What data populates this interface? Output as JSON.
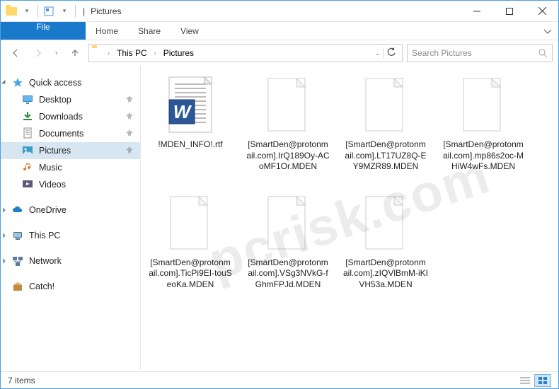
{
  "title_sep": "|",
  "title_loc": "Pictures",
  "ribbon": {
    "file": "File",
    "home": "Home",
    "share": "Share",
    "view": "View"
  },
  "nav": {
    "breadcrumb": [
      "This PC",
      "Pictures"
    ],
    "search_placeholder": "Search Pictures"
  },
  "sidebar": {
    "quick_access": "Quick access",
    "items": [
      {
        "label": "Desktop",
        "pinned": true
      },
      {
        "label": "Downloads",
        "pinned": true
      },
      {
        "label": "Documents",
        "pinned": true
      },
      {
        "label": "Pictures",
        "pinned": true,
        "selected": true
      },
      {
        "label": "Music",
        "pinned": false
      },
      {
        "label": "Videos",
        "pinned": false
      }
    ],
    "onedrive": "OneDrive",
    "thispc": "This PC",
    "network": "Network",
    "catch": "Catch!"
  },
  "files": [
    {
      "name": "!MDEN_INFO!.rtf",
      "type": "rtf"
    },
    {
      "name": "[SmartDen@protonmail.com].IrQ189Oy-ACoMF1Or.MDEN",
      "type": "blank"
    },
    {
      "name": "[SmartDen@protonmail.com].LT17UZ8Q-EY9MZR89.MDEN",
      "type": "blank"
    },
    {
      "name": "[SmartDen@protonmail.com].mp86s2oc-MHiW4wFs.MDEN",
      "type": "blank"
    },
    {
      "name": "[SmartDen@protonmail.com].TicPi9EI-touSeoKa.MDEN",
      "type": "blank"
    },
    {
      "name": "[SmartDen@protonmail.com].VSg3NVkG-fGhmFPJd.MDEN",
      "type": "blank"
    },
    {
      "name": "[SmartDen@protonmail.com].zIQVlBmM-iKIVH53a.MDEN",
      "type": "blank"
    }
  ],
  "status": {
    "count": "7 items"
  },
  "watermark": "pcrisk.com"
}
